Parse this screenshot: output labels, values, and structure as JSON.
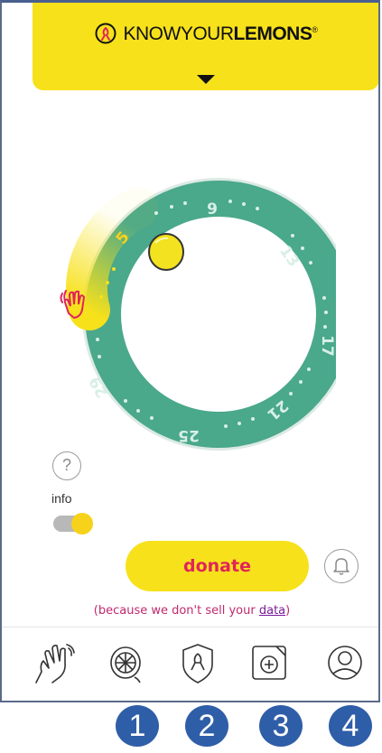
{
  "header": {
    "brand_light": "KNOWYOUR",
    "brand_bold": "LEMONS",
    "brand_reg": "®"
  },
  "cycle": {
    "day_labels": [
      "5",
      "9",
      "13",
      "17",
      "21",
      "25",
      "29"
    ],
    "colors": {
      "ring": "#4aa88b",
      "highlight": "#f7e11b",
      "lemon": "#f3e21f"
    }
  },
  "controls": {
    "help_symbol": "?",
    "info_label": "info",
    "toggle_on": true,
    "donate_label": "donate",
    "note_prefix": "(because we don't sell your ",
    "note_link": "data",
    "note_suffix": ")"
  },
  "nav": [
    {
      "icon": "hand-icon"
    },
    {
      "icon": "lemon-icon"
    },
    {
      "icon": "ribbon-shield-icon"
    },
    {
      "icon": "add-photo-icon"
    },
    {
      "icon": "profile-icon"
    }
  ],
  "badges": [
    "1",
    "2",
    "3",
    "4"
  ],
  "colors": {
    "yellow": "#f7e11b",
    "teal": "#4aa88b",
    "pink": "#e0245a",
    "badge": "#2f5ea8"
  }
}
